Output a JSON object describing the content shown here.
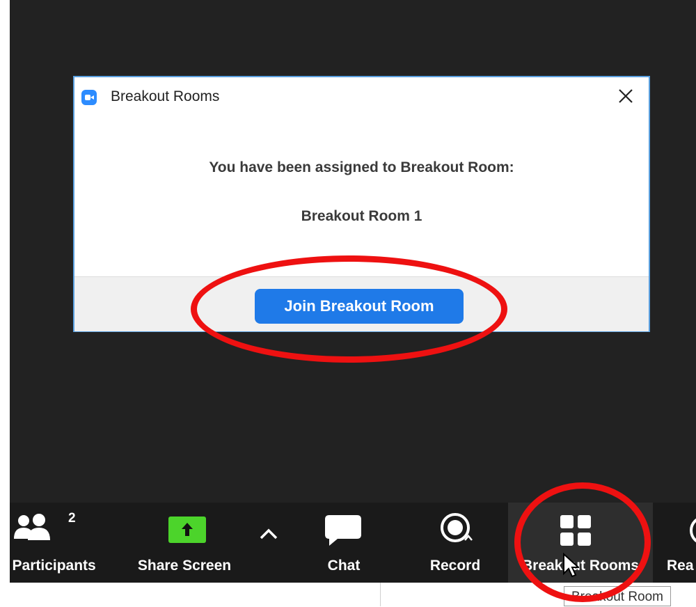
{
  "dialog": {
    "title": "Breakout Rooms",
    "message": "You have been assigned to Breakout Room:",
    "room_name": "Breakout Room 1",
    "join_label": "Join Breakout Room"
  },
  "toolbar": {
    "participants_label": "e Participants",
    "participants_count": "2",
    "share_label": "Share Screen",
    "chat_label": "Chat",
    "record_label": "Record",
    "breakout_label": "Breakout Rooms",
    "reactions_label": "Rea"
  },
  "tooltip": {
    "text": "Breakout Room"
  },
  "colors": {
    "meeting_bg": "#222222",
    "toolbar_bg": "#1a1a1a",
    "join_button": "#1f7ae8",
    "share_green": "#4cd42b",
    "annotation_red": "#ee1111"
  },
  "icons": [
    "zoom-logo-icon",
    "close-icon",
    "participants-icon",
    "share-screen-icon",
    "chevron-up-icon",
    "chat-icon",
    "record-icon",
    "breakout-rooms-icon",
    "reactions-icon",
    "mouse-cursor-icon"
  ]
}
